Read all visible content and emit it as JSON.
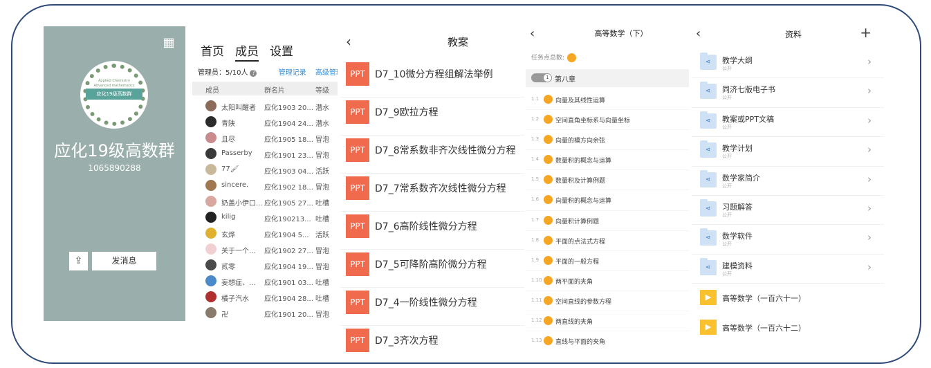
{
  "group_card": {
    "group_name": "应化19级高数群",
    "group_number": "1065890288",
    "qr_icon": "qr-code-icon",
    "logo_banner": "应化19级高数群",
    "logo_top_text": "Applied Chemistry",
    "logo_bottom_text": "Advanced mathematics",
    "share_icon": "share-icon",
    "send_message_label": "发消息"
  },
  "members": {
    "tabs": [
      "首页",
      "成员",
      "设置"
    ],
    "active_tab": "成员",
    "admin_label": "管理员：5/10人",
    "manage_log_link": "管理记录",
    "advanced_link": "高级管理",
    "columns": [
      "成员",
      "群名片",
      "等级"
    ],
    "rows": [
      {
        "name": "太阳叫醒者",
        "card": "应化1903 20...",
        "level": "潜水",
        "color": "#8b6b5a"
      },
      {
        "name": "青陕",
        "card": "应化1904 24...",
        "level": "潜水",
        "color": "#2b2b2b"
      },
      {
        "name": "且尽",
        "card": "应化1905 18...",
        "level": "冒泡",
        "color": "#c98b8b"
      },
      {
        "name": "Passerby",
        "card": "应化1901 23...",
        "level": "冒泡",
        "color": "#3a3a3a"
      },
      {
        "name": "77🖌",
        "card": "应化1903 04...",
        "level": "活跃",
        "color": "#c9b89a"
      },
      {
        "name": "sincere.",
        "card": "应化1902 18...",
        "level": "冒泡",
        "color": "#a07850"
      },
      {
        "name": "奶盖小伊口...",
        "card": "应化1905 27...",
        "level": "吐槽",
        "color": "#d8a8a0"
      },
      {
        "name": "kilig",
        "card": "应化190213...",
        "level": "吐槽",
        "color": "#222222"
      },
      {
        "name": "玄烨",
        "card": "应化1904 5...",
        "level": "活跃",
        "color": "#e0b030"
      },
      {
        "name": "关于一个...",
        "card": "应化1902 27...",
        "level": "冒泡",
        "color": "#f0d0d0"
      },
      {
        "name": "贰零",
        "card": "应化1904 19...",
        "level": "冒泡",
        "color": "#4a4a4a"
      },
      {
        "name": "妄想症、...",
        "card": "应化1901 03...",
        "level": "吐槽",
        "color": "#4a8ac8"
      },
      {
        "name": "橘子汽水",
        "card": "应化1904 28...",
        "level": "吐槽",
        "color": "#b03030"
      },
      {
        "name": "卍",
        "card": "应化1901 20...",
        "level": "冒泡",
        "color": "#8a7a6a"
      }
    ]
  },
  "lectures": {
    "back_icon": "back-chevron-icon",
    "title": "教案",
    "badge": "PPT",
    "items": [
      "D7_10微分方程组解法举例",
      "D7_9欧拉方程",
      "D7_8常系数非齐次线性微分方程",
      "D7_7常系数齐次线性微分方程",
      "D7_6高阶线性微分方程",
      "D7_5可降阶高阶微分方程",
      "D7_4一阶线性微分方程",
      "D7_3齐次方程"
    ]
  },
  "course": {
    "back_icon": "back-chevron-icon",
    "title": "高等数学（下）",
    "total_label": "任务点总数:",
    "total_badge": "",
    "chapter_toggle_num": "1",
    "chapter_name": "第八章",
    "tasks": [
      {
        "no": "1.1",
        "name": "向量及其线性运算"
      },
      {
        "no": "1.2",
        "name": "空间直角坐标系与向量坐标"
      },
      {
        "no": "1.3",
        "name": "向量的模方向余弦"
      },
      {
        "no": "1.4",
        "name": "数量积的概念与运算"
      },
      {
        "no": "1.5",
        "name": "数量积及计算例题"
      },
      {
        "no": "1.6",
        "name": "向量积的概念与运算"
      },
      {
        "no": "1.7",
        "name": "向量积计算例题"
      },
      {
        "no": "1.8",
        "name": "平面的点法式方程"
      },
      {
        "no": "1.9",
        "name": "平面的一般方程"
      },
      {
        "no": "1.10",
        "name": "两平面的夹角"
      },
      {
        "no": "1.11",
        "name": "空间直线的参数方程"
      },
      {
        "no": "1.12",
        "name": "两直线的夹角"
      },
      {
        "no": "1.13",
        "name": "直线与平面的夹角"
      }
    ]
  },
  "materials": {
    "back_icon": "back-chevron-icon",
    "title": "资料",
    "add_icon": "plus-icon",
    "folders": [
      {
        "name": "教学大纲",
        "sub": "公开"
      },
      {
        "name": "同济七版电子书",
        "sub": "公开"
      },
      {
        "name": "教案或PPT文稿",
        "sub": "公开"
      },
      {
        "name": "教学计划",
        "sub": "公开"
      },
      {
        "name": "数学家简介",
        "sub": "公开"
      },
      {
        "name": "习题解答",
        "sub": "公开"
      },
      {
        "name": "数学软件",
        "sub": "公开"
      },
      {
        "name": "建模资料",
        "sub": "公开"
      }
    ],
    "videos": [
      "高等数学（一百六十一）",
      "高等数学（一百六十二）"
    ]
  }
}
